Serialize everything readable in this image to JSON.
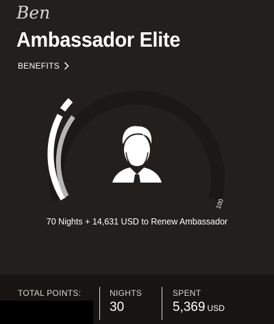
{
  "header": {
    "member_name": "Ben",
    "tier_title": "Ambassador Elite",
    "benefits_label": "BENEFITS"
  },
  "progress": {
    "nights": 30,
    "max_nights": 100,
    "max_label": "100",
    "renew_text": "70 Nights + 14,631 USD to Renew Ambassador"
  },
  "stats": {
    "total_points_label": "TOTAL POINTS:",
    "nights_label": "NIGHTS",
    "nights_value": "30",
    "spent_label": "SPENT",
    "spent_value": "5,369",
    "spent_unit": "USD"
  },
  "colors": {
    "background": "#231f1c",
    "footer_bg": "#171412",
    "gauge_track": "#1b1816",
    "gauge_fill": "#ffffff",
    "gauge_secondary": "#b5b5b5"
  },
  "icons": {
    "avatar": "user-avatar-icon",
    "benefits": "chevron-right-icon"
  }
}
